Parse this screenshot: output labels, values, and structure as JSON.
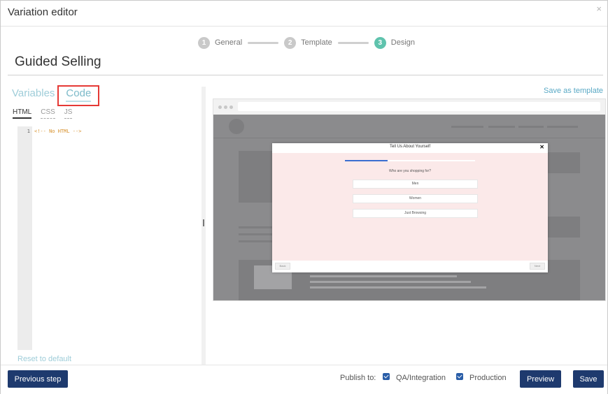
{
  "window": {
    "title": "Variation editor",
    "close_glyph": "×"
  },
  "stepper": {
    "steps": [
      {
        "number": "1",
        "label": "General"
      },
      {
        "number": "2",
        "label": "Template"
      },
      {
        "number": "3",
        "label": "Design"
      }
    ],
    "active_step": 3
  },
  "page_title": "Guided Selling",
  "tabs": {
    "variables": "Variables",
    "code": "Code"
  },
  "subtabs": {
    "html": "HTML",
    "css": "CSS",
    "js": "JS"
  },
  "editor": {
    "line_number": "1",
    "content": "<!-- No HTML -->"
  },
  "reset_label": "Reset to default",
  "save_as_template": "Save as template",
  "preview_modal": {
    "title": "Tell Us About Yourself",
    "close_glyph": "✕",
    "progress": 0.33,
    "question": "Who are you shopping for?",
    "options": [
      "Men",
      "Women",
      "Just Browsing"
    ],
    "back_label": "Back",
    "next_label": "Next"
  },
  "footer": {
    "previous_step": "Previous step",
    "publish_label": "Publish to:",
    "qa_label": "QA/Integration",
    "qa_checked": true,
    "production_label": "Production",
    "production_checked": true,
    "preview": "Preview",
    "save": "Save"
  },
  "colors": {
    "primary_button": "#1e3a6e",
    "active_step": "#5fc3ad",
    "link": "#5aa9c5",
    "highlight_box": "#e53935",
    "code_comment": "#d7912c"
  }
}
